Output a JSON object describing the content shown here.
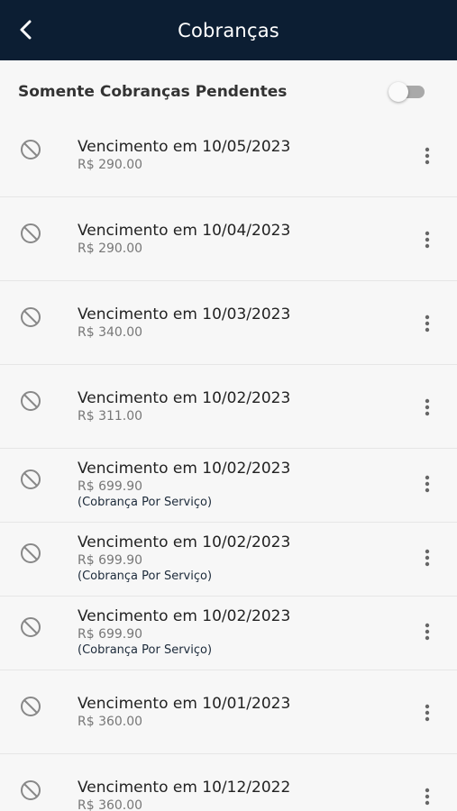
{
  "header": {
    "title": "Cobranças",
    "back_icon": "chevron-left-icon"
  },
  "filter": {
    "label": "Somente Cobranças Pendentes",
    "toggle_on": false
  },
  "charges": [
    {
      "date": "Vencimento em 10/05/2023",
      "amount": "R$ 290.00",
      "note": ""
    },
    {
      "date": "Vencimento em 10/04/2023",
      "amount": "R$ 290.00",
      "note": ""
    },
    {
      "date": "Vencimento em 10/03/2023",
      "amount": "R$ 340.00",
      "note": ""
    },
    {
      "date": "Vencimento em 10/02/2023",
      "amount": "R$ 311.00",
      "note": ""
    },
    {
      "date": "Vencimento em 10/02/2023",
      "amount": "R$ 699.90",
      "note": "(Cobrança Por Serviço)"
    },
    {
      "date": "Vencimento em 10/02/2023",
      "amount": "R$ 699.90",
      "note": "(Cobrança Por Serviço)"
    },
    {
      "date": "Vencimento em 10/02/2023",
      "amount": "R$ 699.90",
      "note": "(Cobrança Por Serviço)"
    },
    {
      "date": "Vencimento em 10/01/2023",
      "amount": "R$ 360.00",
      "note": ""
    },
    {
      "date": "Vencimento em 10/12/2022",
      "amount": "R$ 360.00",
      "note": ""
    }
  ],
  "colors": {
    "header_bg": "#0c1e33",
    "background": "#f7f7f7",
    "icon": "#888888"
  }
}
